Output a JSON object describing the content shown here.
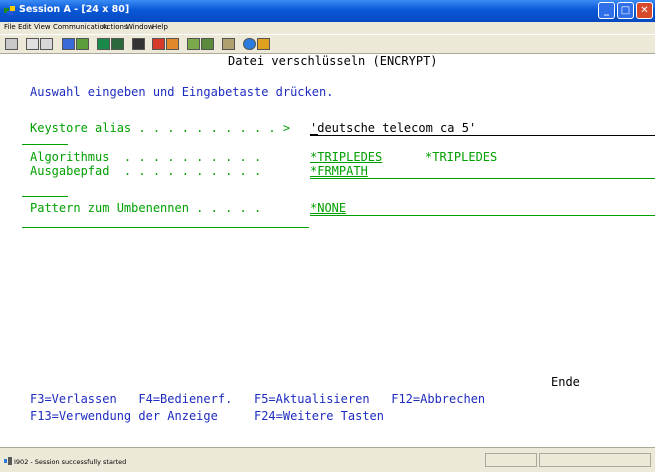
{
  "window": {
    "title": "Session A - [24 x 80]",
    "minimize": "_",
    "maximize": "□",
    "close": "✕"
  },
  "menu": [
    "File",
    "Edit",
    "View",
    "Communication",
    "Actions",
    "Window",
    "Help"
  ],
  "toolbar_icons": [
    "print-icon",
    "copy-icon",
    "paste-icon",
    "send-icon",
    "receive-icon",
    "display-icon",
    "display2-icon",
    "macro-icon",
    "record-icon",
    "stop-icon",
    "keyboard-icon",
    "keyboard2-icon",
    "clipboard-icon",
    "globe-icon",
    "edit-icon"
  ],
  "screen": {
    "title": "Datei verschlüsseln (ENCRYPT)",
    "instruction": "Auswahl eingeben und Eingabetaste drücken.",
    "keystore_label": "Keystore alias . . . . . . . . . . >",
    "keystore_value": "'deutsche telecom ca 5'",
    "algorithm_label": "Algorithmus  . . . . . . . . . .",
    "algorithm_value": "*TRIPLEDES",
    "algorithm_default": "*TRIPLEDES",
    "output_path_label": "Ausgabepfad  . . . . . . . . . .",
    "output_path_value": "*FRMPATH",
    "pattern_label": "Pattern zum Umbenennen . . . . .",
    "pattern_value": "*NONE",
    "more_indicator": "Ende",
    "fkeys_line1": "F3=Verlassen   F4=Bedienerf.   F5=Aktualisieren   F12=Abbrechen",
    "fkeys_line2": "F13=Verwendung der Anzeige     F24=Weitere Tasten"
  },
  "status": {
    "message": "I902 - Session successfully started"
  }
}
